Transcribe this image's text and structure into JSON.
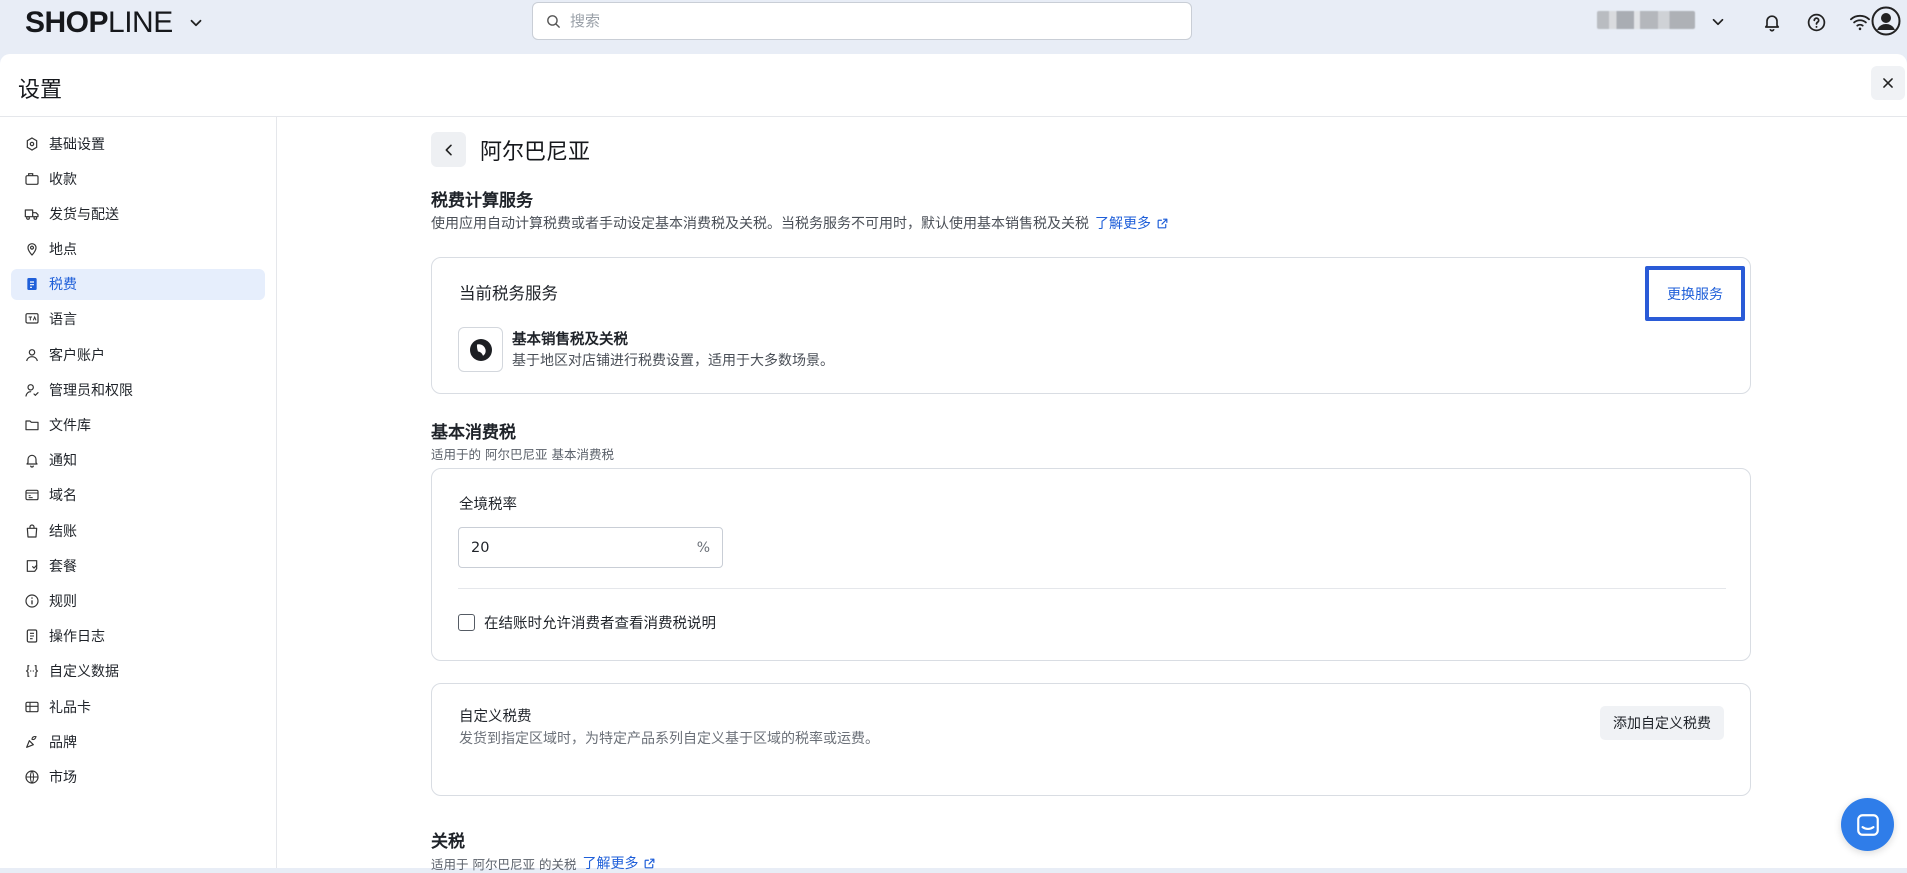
{
  "topbar": {
    "logo_left": "SHOP",
    "logo_right": "LINE",
    "search_placeholder": "搜索",
    "icons": [
      "chevron-down-icon",
      "search-icon",
      "bell-icon",
      "help-icon",
      "wifi-icon",
      "account-icon"
    ]
  },
  "header": {
    "title": "设置"
  },
  "sidebar": {
    "items": [
      {
        "label": "基础设置",
        "icon": "store-settings-icon"
      },
      {
        "label": "收款",
        "icon": "payment-icon"
      },
      {
        "label": "发货与配送",
        "icon": "truck-icon"
      },
      {
        "label": "地点",
        "icon": "location-pin-icon"
      },
      {
        "label": "税费",
        "icon": "tax-receipt-icon",
        "active": true
      },
      {
        "label": "语言",
        "icon": "language-icon"
      },
      {
        "label": "客户账户",
        "icon": "user-icon"
      },
      {
        "label": "管理员和权限",
        "icon": "user-permission-icon"
      },
      {
        "label": "文件库",
        "icon": "folder-icon"
      },
      {
        "label": "通知",
        "icon": "bell-icon"
      },
      {
        "label": "域名",
        "icon": "domain-icon"
      },
      {
        "label": "结账",
        "icon": "shopping-bag-icon"
      },
      {
        "label": "套餐",
        "icon": "plan-icon"
      },
      {
        "label": "规则",
        "icon": "info-icon"
      },
      {
        "label": "操作日志",
        "icon": "log-icon"
      },
      {
        "label": "自定义数据",
        "icon": "custom-data-icon"
      },
      {
        "label": "礼品卡",
        "icon": "gift-card-icon"
      },
      {
        "label": "品牌",
        "icon": "brand-icon"
      },
      {
        "label": "市场",
        "icon": "globe-icon"
      }
    ]
  },
  "content": {
    "page_title": "阿尔巴尼亚",
    "tax_service": {
      "title": "税费计算服务",
      "desc": "使用应用自动计算税费或者手动设定基本消费税及关税。当税务服务不可用时，默认使用基本销售税及关税",
      "learn_more": "了解更多",
      "card_title": "当前税务服务",
      "change_button": "更换服务",
      "service_name": "基本销售税及关税",
      "service_desc": "基于地区对店铺进行税费设置，适用于大多数场景。"
    },
    "basic_tax": {
      "title": "基本消费税",
      "desc": "适用于的 阿尔巴尼亚 基本消费税",
      "rate_label": "全境税率",
      "rate_value": "20",
      "rate_unit": "%",
      "checkbox_label": "在结账时允许消费者查看消费税说明",
      "checkbox_checked": false
    },
    "custom_tax": {
      "title": "自定义税费",
      "desc": "发货到指定区域时，为特定产品系列自定义基于区域的税率或运费。",
      "add_button": "添加自定义税费"
    },
    "duties": {
      "title": "关税",
      "desc": "适用于 阿尔巴尼亚 的关税",
      "learn_more": "了解更多"
    }
  },
  "colors": {
    "accent": "#1f5fd9",
    "active_bg": "#e6eefc",
    "highlight_border": "#2a5bd7",
    "chat_fab": "#2f7de9"
  }
}
